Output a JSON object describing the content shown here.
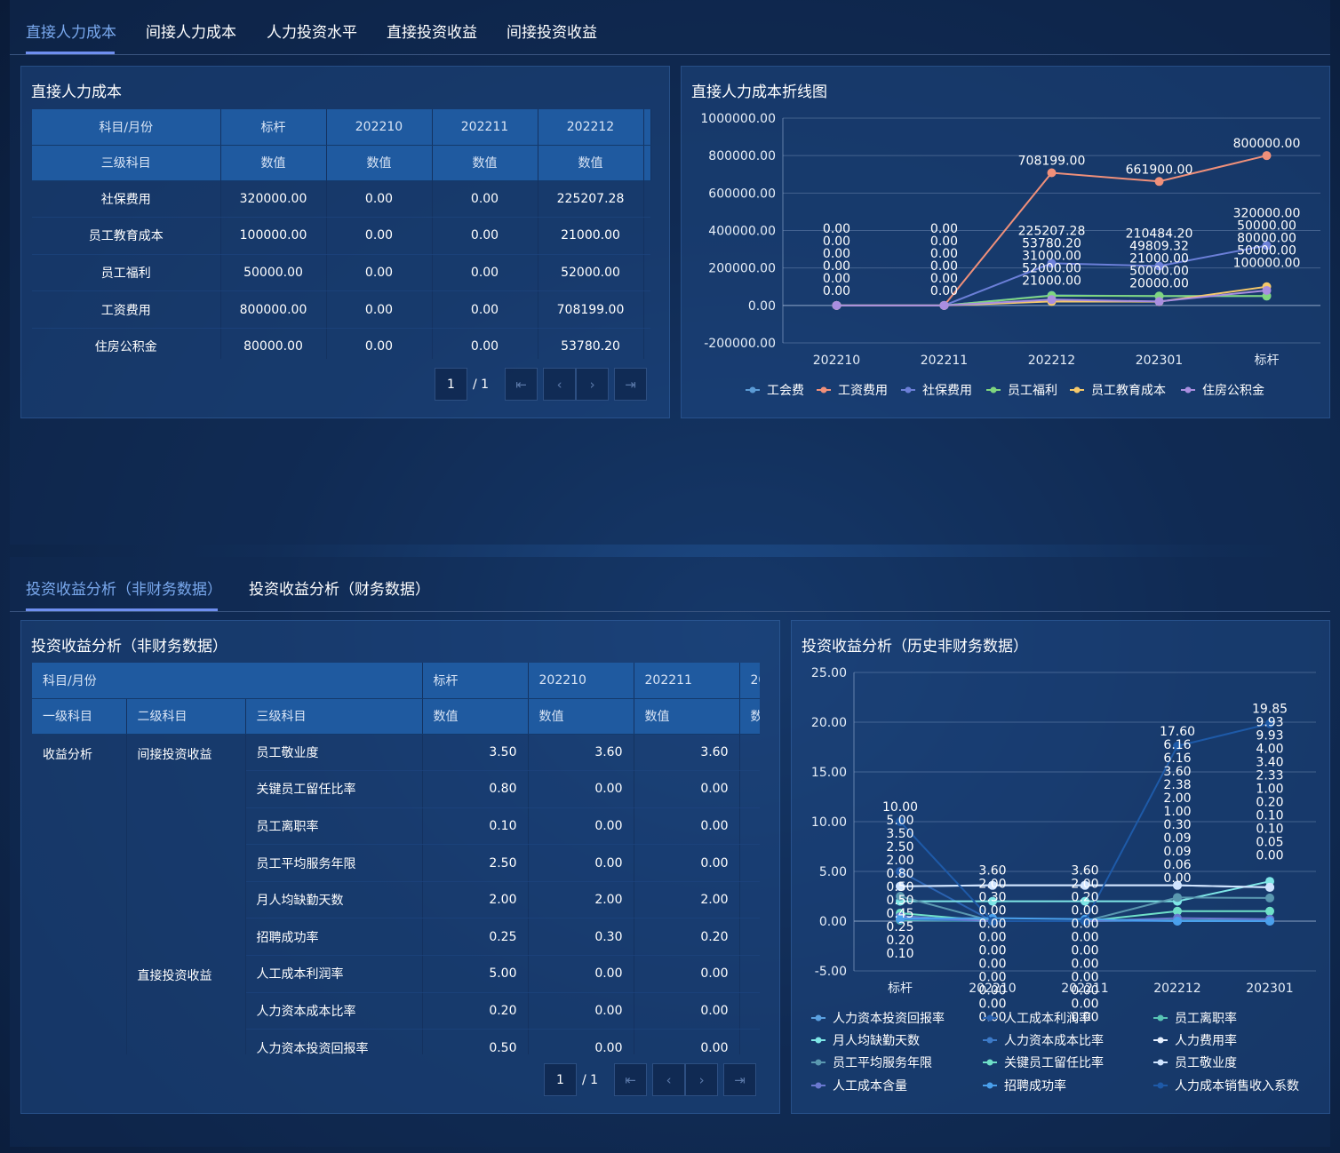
{
  "top_tabs": [
    "直接人力成本",
    "间接人力成本",
    "人力投资水平",
    "直接投资收益",
    "间接投资收益"
  ],
  "bottom_tabs": [
    "投资收益分析（非财务数据）",
    "投资收益分析（财务数据）"
  ],
  "table1": {
    "title": "直接人力成本",
    "header1": [
      "科目/月份",
      "标杆",
      "202210",
      "202211",
      "202212"
    ],
    "header2": [
      "三级科目",
      "数值",
      "数值",
      "数值",
      "数值"
    ],
    "rows": [
      [
        "社保费用",
        "320000.00",
        "0.00",
        "0.00",
        "225207.28"
      ],
      [
        "员工教育成本",
        "100000.00",
        "0.00",
        "0.00",
        "21000.00"
      ],
      [
        "员工福利",
        "50000.00",
        "0.00",
        "0.00",
        "52000.00"
      ],
      [
        "工资费用",
        "800000.00",
        "0.00",
        "0.00",
        "708199.00"
      ],
      [
        "住房公积金",
        "80000.00",
        "0.00",
        "0.00",
        "53780.20"
      ]
    ],
    "pager": {
      "page": "1",
      "total": "/ 1"
    }
  },
  "icons": {
    "first": "⇤",
    "prev": "‹",
    "next": "›",
    "last": "⇥"
  },
  "chart1": {
    "title": "直接人力成本折线图"
  },
  "table2": {
    "title": "投资收益分析（非财务数据）",
    "header1": [
      "科目/月份",
      "标杆",
      "202210",
      "202211",
      "20"
    ],
    "header2": [
      "一级科目",
      "二级科目",
      "三级科目",
      "数值",
      "数值",
      "数值",
      "数"
    ],
    "groups": [
      "收益分析",
      "间接投资收益",
      "直接投资收益"
    ],
    "rows": [
      [
        "员工敬业度",
        "3.50",
        "3.60",
        "3.60"
      ],
      [
        "关键员工留任比率",
        "0.80",
        "0.00",
        "0.00"
      ],
      [
        "员工离职率",
        "0.10",
        "0.00",
        "0.00"
      ],
      [
        "员工平均服务年限",
        "2.50",
        "0.00",
        "0.00"
      ],
      [
        "月人均缺勤天数",
        "2.00",
        "2.00",
        "2.00"
      ],
      [
        "招聘成功率",
        "0.25",
        "0.30",
        "0.20"
      ],
      [
        "人工成本利润率",
        "5.00",
        "0.00",
        "0.00"
      ],
      [
        "人力资本成本比率",
        "0.20",
        "0.00",
        "0.00"
      ],
      [
        "人力资本投资回报率",
        "0.50",
        "0.00",
        "0.00"
      ]
    ],
    "pager": {
      "page": "1",
      "total": "/ 1"
    }
  },
  "chart2": {
    "title": "投资收益分析（历史非财务数据）"
  },
  "chart_data": [
    {
      "type": "line",
      "title": "直接人力成本折线图",
      "categories": [
        "202210",
        "202211",
        "202212",
        "202301",
        "标杆"
      ],
      "ylim": [
        -200000,
        1000000
      ],
      "yticks": [
        "1000000.00",
        "800000.00",
        "600000.00",
        "400000.00",
        "200000.00",
        "0.00",
        "-200000.00"
      ],
      "legend_position": "bottom",
      "series": [
        {
          "name": "工会费",
          "color": "#5b9bd5",
          "values": [
            0,
            0,
            53780.2,
            49809.32,
            50000
          ],
          "labels": [
            "0.00",
            "0.00",
            "53780.20",
            "49809.32",
            "50000.00"
          ]
        },
        {
          "name": "工资费用",
          "color": "#f0907a",
          "values": [
            0,
            0,
            708199,
            661900,
            800000
          ],
          "labels": [
            "0.00",
            "0.00",
            "708199.00",
            "661900.00",
            "800000.00"
          ]
        },
        {
          "name": "社保费用",
          "color": "#6b7fd8",
          "values": [
            0,
            0,
            225207.28,
            210484.2,
            320000
          ],
          "labels": [
            "0.00",
            "0.00",
            "225207.28",
            "210484.20",
            "320000.00"
          ]
        },
        {
          "name": "员工福利",
          "color": "#7fd67f",
          "values": [
            0,
            0,
            52000,
            50000,
            50000
          ],
          "labels": [
            "0.00",
            "0.00",
            "52000.00",
            "50000.00",
            "50000.00"
          ]
        },
        {
          "name": "员工教育成本",
          "color": "#f5c86a",
          "values": [
            0,
            0,
            21000,
            20000,
            100000
          ],
          "labels": [
            "0.00",
            "0.00",
            "21000.00",
            "20000.00",
            "100000.00"
          ]
        },
        {
          "name": "住房公积金",
          "color": "#a98ee0",
          "values": [
            0,
            0,
            31000,
            21000,
            80000
          ],
          "labels": [
            "0.00",
            "0.00",
            "31000.00",
            "21000.00",
            "80000.00"
          ]
        }
      ]
    },
    {
      "type": "line",
      "title": "投资收益分析（历史非财务数据）",
      "categories": [
        "标杆",
        "202210",
        "202211",
        "202212",
        "202301"
      ],
      "ylim": [
        -5,
        25
      ],
      "yticks": [
        "25.00",
        "20.00",
        "15.00",
        "10.00",
        "5.00",
        "0.00",
        "-5.00"
      ],
      "legend_position": "bottom",
      "series": [
        {
          "name": "人力资本投资回报率",
          "color": "#5aa0e0",
          "values": [
            0.5,
            0,
            0,
            0,
            0
          ]
        },
        {
          "name": "人工成本利润率",
          "color": "#2a62b0",
          "values": [
            5,
            0,
            0,
            0,
            0
          ]
        },
        {
          "name": "员工离职率",
          "color": "#58c4b4",
          "values": [
            0.1,
            0,
            0,
            0.09,
            0.1
          ]
        },
        {
          "name": "月人均缺勤天数",
          "color": "#7ee6e6",
          "values": [
            2,
            2,
            2,
            2,
            4
          ]
        },
        {
          "name": "人力资本成本比率",
          "color": "#3c7ac8",
          "values": [
            0.2,
            0,
            0,
            0.06,
            0.05
          ]
        },
        {
          "name": "人力费用率",
          "color": "#e6f0ff",
          "values": [
            3.5,
            3.6,
            3.6,
            3.6,
            3.4
          ]
        },
        {
          "name": "员工平均服务年限",
          "color": "#5a98b0",
          "values": [
            2.5,
            0,
            0,
            2.38,
            2.33
          ]
        },
        {
          "name": "关键员工留任比率",
          "color": "#6fe0c8",
          "values": [
            0.8,
            0,
            0,
            1,
            1
          ]
        },
        {
          "name": "员工敬业度",
          "color": "#cfe4ff",
          "values": [
            3.5,
            3.6,
            3.6,
            3.6,
            3.4
          ]
        },
        {
          "name": "人工成本含量",
          "color": "#6a78d0",
          "values": [
            0.45,
            0,
            0,
            0.3,
            0.2
          ]
        },
        {
          "name": "招聘成功率",
          "color": "#4aa0ec",
          "values": [
            0.25,
            0.3,
            0.2,
            0,
            0
          ]
        },
        {
          "name": "人力成本销售收入系数",
          "color": "#1e5aa8",
          "values": [
            10,
            0,
            0,
            17.6,
            19.85
          ]
        }
      ],
      "point_labels": [
        [
          "10.00",
          "5.00",
          "3.50",
          "2.50",
          "2.00",
          "0.80",
          "0.50",
          "0.50",
          "0.45",
          "0.25",
          "0.20",
          "0.10"
        ],
        [
          "3.60",
          "2.00",
          "0.30",
          "0.00",
          "0.00",
          "0.00",
          "0.00",
          "0.00",
          "0.00",
          "0.00",
          "0.00",
          "0.00"
        ],
        [
          "3.60",
          "2.00",
          "0.20",
          "0.00",
          "0.00",
          "0.00",
          "0.00",
          "0.00",
          "0.00",
          "0.00",
          "0.00",
          "0.00"
        ],
        [
          "17.60",
          "6.16",
          "6.16",
          "3.60",
          "2.38",
          "2.00",
          "1.00",
          "0.30",
          "0.09",
          "0.09",
          "0.06",
          "0.00"
        ],
        [
          "19.85",
          "9.93",
          "9.93",
          "4.00",
          "3.40",
          "2.33",
          "1.00",
          "0.20",
          "0.10",
          "0.10",
          "0.05",
          "0.00"
        ]
      ]
    }
  ]
}
